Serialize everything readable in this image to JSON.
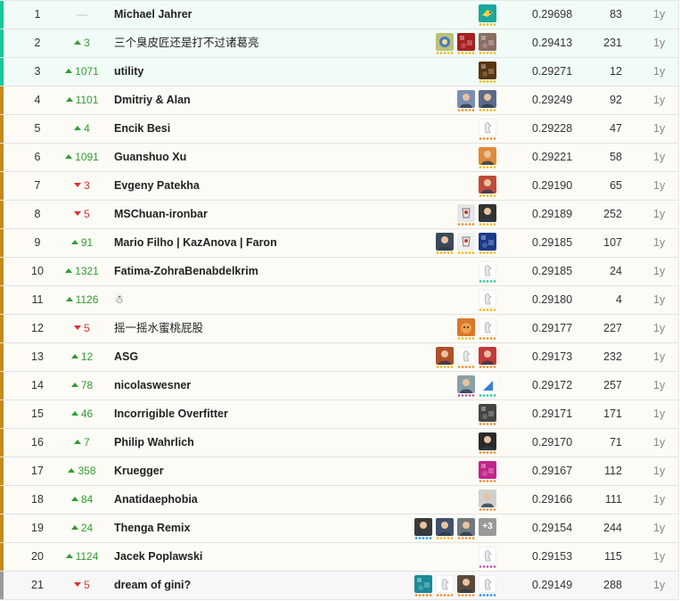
{
  "colors": {
    "gold": "#f2e9c6",
    "silver": "#eeeeee",
    "bronze": "#f3e2cf"
  },
  "leaderboard": [
    {
      "rank": "1",
      "change": "—",
      "dir": "none",
      "team": "Michael Jahrer",
      "score": "0.29698",
      "entries": "83",
      "last": "1y",
      "band": "#16c79a",
      "bg": "#f1fbf7",
      "avatars": [
        {
          "icon": "fish-avatar",
          "bg": "#1aa89c",
          "dots": "#f2b705"
        }
      ]
    },
    {
      "rank": "2",
      "change": "3",
      "dir": "up",
      "team": "三个臭皮匠还是打不过诸葛亮",
      "score": "0.29413",
      "entries": "231",
      "last": "1y",
      "band": "#16c79a",
      "bg": "#f1fbf7",
      "avatars": [
        {
          "icon": "cartoon-avatar",
          "bg": "#b9c27a",
          "dots": "#f2b705"
        },
        {
          "icon": "photo-avatar",
          "bg": "#a52020",
          "dots": "#f2b705"
        },
        {
          "icon": "photo-avatar",
          "bg": "#8a6d63",
          "dots": "#f2b705"
        }
      ]
    },
    {
      "rank": "3",
      "change": "1071",
      "dir": "up",
      "team": "utility",
      "score": "0.29271",
      "entries": "12",
      "last": "1y",
      "band": "#16c79a",
      "bg": "#f1fbf7",
      "avatars": [
        {
          "icon": "pattern-avatar",
          "bg": "#5a3510",
          "dots": "#f2b705"
        }
      ]
    },
    {
      "rank": "4",
      "change": "1101",
      "dir": "up",
      "team": "Dmitriy & Alan",
      "score": "0.29249",
      "entries": "92",
      "last": "1y",
      "band": "#c58a1c",
      "bg": "#fcfbf6",
      "avatars": [
        {
          "icon": "person-avatar",
          "bg": "#7a8fb3",
          "dots": "#f08a24"
        },
        {
          "icon": "person-avatar",
          "bg": "#5c6a8a",
          "dots": "#f2b705"
        }
      ]
    },
    {
      "rank": "5",
      "change": "4",
      "dir": "up",
      "team": "Encik Besi",
      "score": "0.29228",
      "entries": "47",
      "last": "1y",
      "band": "#c58a1c",
      "bg": "#fcfbf6",
      "avatars": [
        {
          "icon": "goose-avatar",
          "bg": "#ffffff",
          "dots": "#f08a24"
        }
      ]
    },
    {
      "rank": "6",
      "change": "1091",
      "dir": "up",
      "team": "Guanshuo Xu",
      "score": "0.29221",
      "entries": "58",
      "last": "1y",
      "band": "#c58a1c",
      "bg": "#fcfbf6",
      "avatars": [
        {
          "icon": "person-avatar",
          "bg": "#e08a3a",
          "dots": "#f2b705"
        }
      ]
    },
    {
      "rank": "7",
      "change": "3",
      "dir": "down",
      "team": "Evgeny Patekha",
      "score": "0.29190",
      "entries": "65",
      "last": "1y",
      "band": "#c58a1c",
      "bg": "#fcfbf6",
      "avatars": [
        {
          "icon": "person-avatar",
          "bg": "#c24a3a",
          "dots": "#f2b705"
        }
      ]
    },
    {
      "rank": "8",
      "change": "5",
      "dir": "down",
      "team": "MSChuan-ironbar",
      "score": "0.29189",
      "entries": "252",
      "last": "1y",
      "band": "#c58a1c",
      "bg": "#fcfbf6",
      "avatars": [
        {
          "icon": "robot-avatar",
          "bg": "#e6e6e6",
          "dots": "#f08a24"
        },
        {
          "icon": "person-avatar",
          "bg": "#333333",
          "dots": "#f2b705"
        }
      ]
    },
    {
      "rank": "9",
      "change": "91",
      "dir": "up",
      "team": "Mario Filho | KazAnova | Faron",
      "score": "0.29185",
      "entries": "107",
      "last": "1y",
      "band": "#c58a1c",
      "bg": "#fcfbf6",
      "avatars": [
        {
          "icon": "person-avatar",
          "bg": "#3a4a5a",
          "dots": "#f2b705"
        },
        {
          "icon": "sketch-avatar",
          "bg": "#f0f0f0",
          "dots": "#f2b705"
        },
        {
          "icon": "pattern-avatar",
          "bg": "#1a3a8a",
          "dots": "#f2b705"
        }
      ]
    },
    {
      "rank": "10",
      "change": "1321",
      "dir": "up",
      "team": "Fatima-ZohraBenabdelkrim",
      "score": "0.29185",
      "entries": "24",
      "last": "1y",
      "band": "#c58a1c",
      "bg": "#fcfbf6",
      "avatars": [
        {
          "icon": "goose-avatar",
          "bg": "#ffffff",
          "dots": "#20c997"
        }
      ]
    },
    {
      "rank": "11",
      "change": "1126",
      "dir": "up",
      "team": "☃",
      "score": "0.29180",
      "entries": "4",
      "last": "1y",
      "band": "#c58a1c",
      "bg": "#fcfbf6",
      "avatars": [
        {
          "icon": "goose-avatar",
          "bg": "#ffffff",
          "dots": "#f2b705"
        }
      ]
    },
    {
      "rank": "12",
      "change": "5",
      "dir": "down",
      "team": "摇一摇水蜜桃屁股",
      "score": "0.29177",
      "entries": "227",
      "last": "1y",
      "band": "#c58a1c",
      "bg": "#fcfbf6",
      "avatars": [
        {
          "icon": "cat-avatar",
          "bg": "#d9782a",
          "dots": "#f2b705"
        },
        {
          "icon": "goose-avatar",
          "bg": "#ffffff",
          "dots": "#f08a24"
        }
      ]
    },
    {
      "rank": "13",
      "change": "12",
      "dir": "up",
      "team": "ASG",
      "score": "0.29173",
      "entries": "232",
      "last": "1y",
      "band": "#c58a1c",
      "bg": "#fcfbf6",
      "avatars": [
        {
          "icon": "person-avatar",
          "bg": "#b0502a",
          "dots": "#f2b705"
        },
        {
          "icon": "goose-avatar",
          "bg": "#ffffff",
          "dots": "#f08a24"
        },
        {
          "icon": "person-avatar",
          "bg": "#c23a3a",
          "dots": "#f08a24"
        }
      ]
    },
    {
      "rank": "14",
      "change": "78",
      "dir": "up",
      "team": "nicolaswesner",
      "score": "0.29172",
      "entries": "257",
      "last": "1y",
      "band": "#c58a1c",
      "bg": "#fcfbf6",
      "avatars": [
        {
          "icon": "person-avatar",
          "bg": "#8aa0a8",
          "dots": "#b84fa5"
        },
        {
          "icon": "triangle-avatar",
          "bg": "#ffffff",
          "dots": "#20c997"
        }
      ]
    },
    {
      "rank": "15",
      "change": "46",
      "dir": "up",
      "team": "Incorrigible Overfitter",
      "score": "0.29171",
      "entries": "171",
      "last": "1y",
      "band": "#c58a1c",
      "bg": "#fcfbf6",
      "avatars": [
        {
          "icon": "pattern-avatar",
          "bg": "#444444",
          "dots": "#f08a24"
        }
      ]
    },
    {
      "rank": "16",
      "change": "7",
      "dir": "up",
      "team": "Philip Wahrlich",
      "score": "0.29170",
      "entries": "71",
      "last": "1y",
      "band": "#c58a1c",
      "bg": "#fcfbf6",
      "avatars": [
        {
          "icon": "person-avatar",
          "bg": "#2a2a2a",
          "dots": "#f08a24"
        }
      ]
    },
    {
      "rank": "17",
      "change": "358",
      "dir": "up",
      "team": "Kruegger",
      "score": "0.29167",
      "entries": "112",
      "last": "1y",
      "band": "#c58a1c",
      "bg": "#fcfbf6",
      "avatars": [
        {
          "icon": "pattern-avatar",
          "bg": "#c2248a",
          "dots": "#f08a24"
        }
      ]
    },
    {
      "rank": "18",
      "change": "84",
      "dir": "up",
      "team": "Anatidaephobia",
      "score": "0.29166",
      "entries": "111",
      "last": "1y",
      "band": "#c58a1c",
      "bg": "#fcfbf6",
      "avatars": [
        {
          "icon": "person-avatar",
          "bg": "#d0d0d0",
          "dots": "#f08a24"
        }
      ]
    },
    {
      "rank": "19",
      "change": "24",
      "dir": "up",
      "team": "Thenga Remix",
      "score": "0.29154",
      "entries": "244",
      "last": "1y",
      "band": "#c58a1c",
      "bg": "#fcfbf6",
      "avatars": [
        {
          "icon": "person-avatar",
          "bg": "#3a3a3a",
          "dots": "#1e90ff"
        },
        {
          "icon": "person-avatar",
          "bg": "#405070",
          "dots": "#f2b705"
        },
        {
          "icon": "person-avatar",
          "bg": "#707880",
          "dots": "#f08a24"
        }
      ],
      "more": "+3"
    },
    {
      "rank": "20",
      "change": "1124",
      "dir": "up",
      "team": "Jacek Poplawski",
      "score": "0.29153",
      "entries": "115",
      "last": "1y",
      "band": "#c58a1c",
      "bg": "#fcfbf6",
      "avatars": [
        {
          "icon": "goose-avatar",
          "bg": "#ffffff",
          "dots": "#b84fa5"
        }
      ]
    },
    {
      "rank": "21",
      "change": "5",
      "dir": "down",
      "team": "dream of gini?",
      "score": "0.29149",
      "entries": "288",
      "last": "1y",
      "band": "#9a9a9a",
      "bg": "#f7f7f7",
      "avatars": [
        {
          "icon": "pattern-avatar",
          "bg": "#1a8a9a",
          "dots": "#f08a24"
        },
        {
          "icon": "goose-avatar",
          "bg": "#ffffff",
          "dots": "#f08a24"
        },
        {
          "icon": "person-avatar",
          "bg": "#5a4a3a",
          "dots": "#f08a24"
        },
        {
          "icon": "goose-avatar",
          "bg": "#ffffff",
          "dots": "#1e90ff"
        }
      ]
    }
  ]
}
